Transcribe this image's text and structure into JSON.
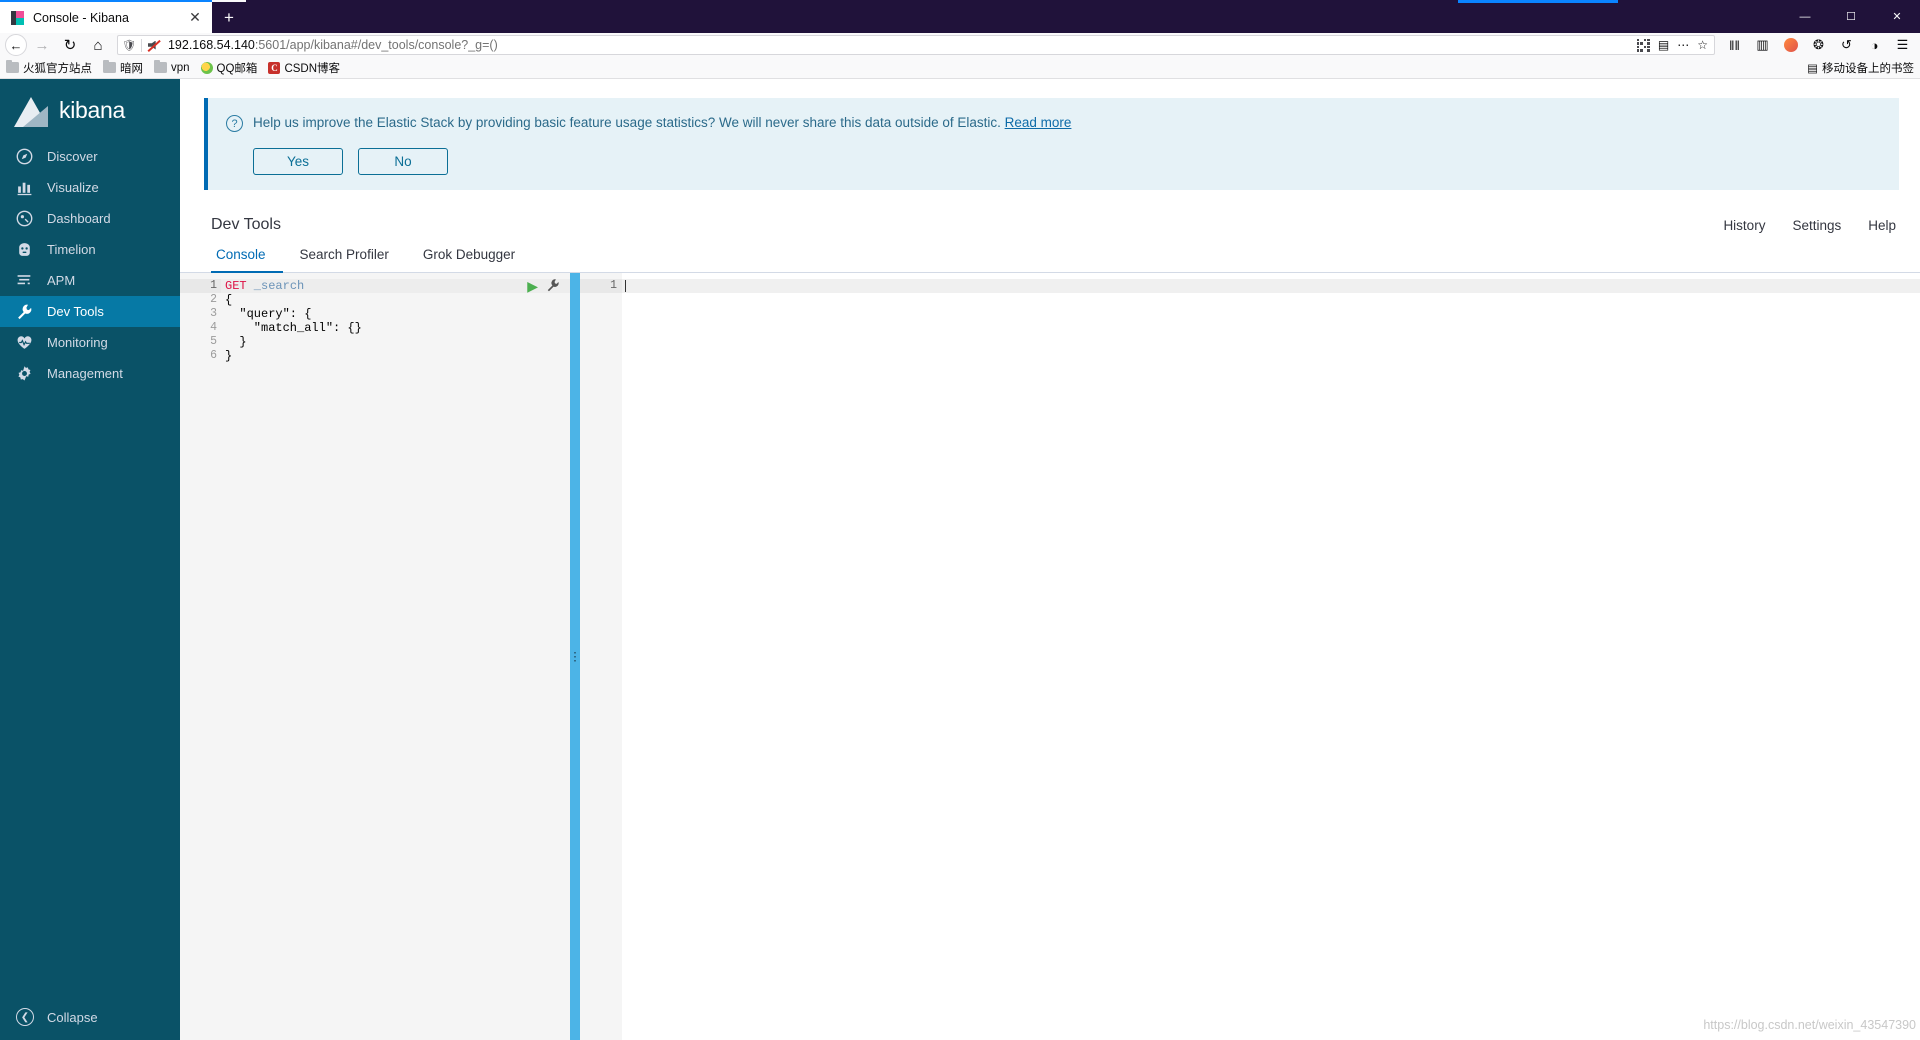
{
  "browser": {
    "tab": {
      "title": "Console - Kibana",
      "favicon": "kibana-favicon",
      "close": "✕"
    },
    "newtab_label": "+",
    "window_controls": {
      "minimize": "—",
      "maximize": "☐",
      "close": "✕"
    },
    "nav": {
      "back": "←",
      "forward": "→",
      "reload": "↻",
      "home": "⌂"
    },
    "url": {
      "host": "192.168.54.140",
      "rest": ":5601/app/kibana#/dev_tools/console?_g=()"
    },
    "url_icons": {
      "shield": "shield-icon",
      "noscript": "noscript-icon",
      "qr": "qr-icon",
      "reader": "▤",
      "menu": "⋯",
      "star": "☆"
    },
    "toolbar_right": {
      "library": "‖‖",
      "sidebar": "▥",
      "account": "account-avatar",
      "container": "❂",
      "history": "↺",
      "shield2": "◑",
      "appmenu": "☰"
    },
    "bookmarks": [
      {
        "label": "火狐官方站点",
        "icon": "folder"
      },
      {
        "label": "暗网",
        "icon": "folder"
      },
      {
        "label": "vpn",
        "icon": "folder"
      },
      {
        "label": "QQ邮箱",
        "icon": "qq"
      },
      {
        "label": "CSDN博客",
        "icon": "csdn",
        "glyph": "C"
      }
    ],
    "bookmarks_right": {
      "label": "移动设备上的书签",
      "icon": "▤"
    }
  },
  "kibana": {
    "brand": "kibana",
    "nav": [
      {
        "label": "Discover",
        "icon": "compass-icon",
        "active": false
      },
      {
        "label": "Visualize",
        "icon": "bar-chart-icon",
        "active": false
      },
      {
        "label": "Dashboard",
        "icon": "dashboard-icon",
        "active": false
      },
      {
        "label": "Timelion",
        "icon": "timelion-icon",
        "active": false
      },
      {
        "label": "APM",
        "icon": "apm-icon",
        "active": false
      },
      {
        "label": "Dev Tools",
        "icon": "wrench-icon",
        "active": true
      },
      {
        "label": "Monitoring",
        "icon": "heart-pulse-icon",
        "active": false
      },
      {
        "label": "Management",
        "icon": "gear-icon",
        "active": false
      }
    ],
    "collapse": {
      "label": "Collapse",
      "icon": "chevron-left-circle-icon"
    },
    "banner": {
      "icon": "question-circle-icon",
      "text": "Help us improve the Elastic Stack by providing basic feature usage statistics? We will never share this data outside of Elastic.",
      "link": "Read more",
      "yes_label": "Yes",
      "no_label": "No"
    },
    "page_title": "Dev Tools",
    "header_links": [
      "History",
      "Settings",
      "Help"
    ],
    "tabs": [
      {
        "label": "Console",
        "active": true
      },
      {
        "label": "Search Profiler",
        "active": false
      },
      {
        "label": "Grok Debugger",
        "active": false
      }
    ],
    "editor": {
      "gutter": [
        {
          "num": "1",
          "fold": "",
          "current": true
        },
        {
          "num": "2",
          "fold": "▾",
          "current": false
        },
        {
          "num": "3",
          "fold": "▾",
          "current": false
        },
        {
          "num": "4",
          "fold": "",
          "current": false
        },
        {
          "num": "5",
          "fold": "▴",
          "current": false
        },
        {
          "num": "6",
          "fold": "▴",
          "current": false
        }
      ],
      "lines": [
        {
          "method": "GET",
          "url": " _search",
          "raw": "",
          "current": true
        },
        {
          "raw": "{",
          "current": false
        },
        {
          "raw": "  \"query\": {",
          "current": false
        },
        {
          "raw": "    \"match_all\": {}",
          "current": false
        },
        {
          "raw": "  }",
          "current": false
        },
        {
          "raw": "}",
          "current": false
        }
      ],
      "actions": {
        "play": "▶",
        "wrench": "wrench-icon"
      }
    },
    "output": {
      "gutter": [
        {
          "num": "1",
          "current": true
        }
      ]
    },
    "splitter_grip": "⋮",
    "watermark": "https://blog.csdn.net/weixin_43547390"
  }
}
